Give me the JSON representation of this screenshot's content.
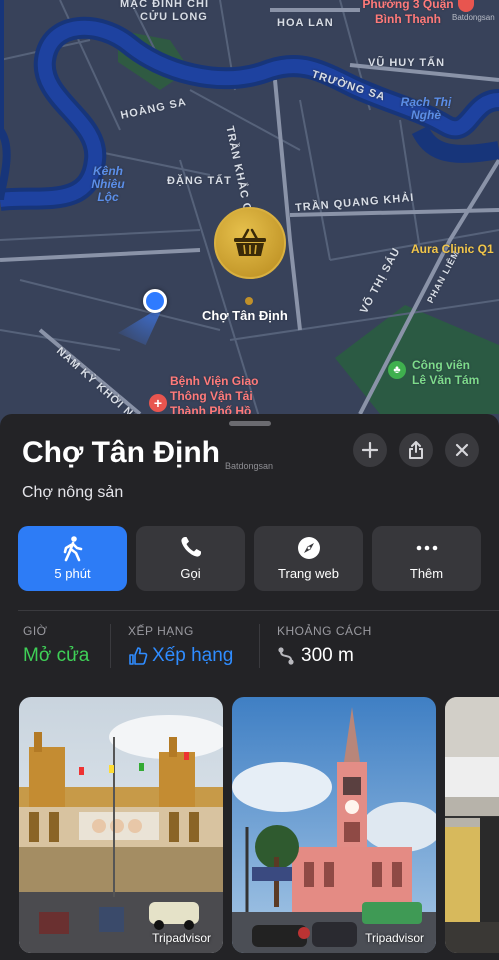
{
  "map": {
    "streets": [
      "MẠC ĐĨNH CHI",
      "CỬU LONG",
      "HOÀNG SA",
      "ĐẶNG TẤT",
      "TRẦN KHẮC CHÂN",
      "TRƯỜNG SA",
      "TRẦN QUANG KHẢI",
      "HOA LAN",
      "VŨ HUY TẤN",
      "VÕ THỊ SÁU",
      "PHAN LIÊM",
      "NAM KỲ KHỞI NG"
    ],
    "water_labels": [
      "Kênh Nhiêu Lộc",
      "Rạch Thị Nghè"
    ],
    "poi_labels": {
      "ward": "Phường 3 Quận Bình Thạnh",
      "clinic": "Aura Clinic Q1",
      "hospital": "Bệnh Viện Giao Thông Vận Tải Thành Phố Hồ",
      "park": "Công viên Lê Văn Tám",
      "market": "Chợ Tân Định"
    },
    "watermark": "Batdongsan"
  },
  "place": {
    "name": "Chợ Tân Định",
    "category": "Chợ nông sản",
    "watermark": "Batdongsan"
  },
  "actions": [
    {
      "label": "5 phút",
      "icon": "walk-icon"
    },
    {
      "label": "Gọi",
      "icon": "phone-icon"
    },
    {
      "label": "Trang web",
      "icon": "compass-icon"
    },
    {
      "label": "Thêm",
      "icon": "more-icon"
    }
  ],
  "info": {
    "hours": {
      "header": "GIỜ",
      "value": "Mở cửa"
    },
    "rating": {
      "header": "XẾP HẠNG",
      "value": "Xếp hạng"
    },
    "distance": {
      "header": "KHOẢNG CÁCH",
      "value": "300 m"
    }
  },
  "photos": [
    {
      "caption": "Tripadvisor"
    },
    {
      "caption": "Tripadvisor"
    }
  ],
  "colors": {
    "primary": "#2d7cf6",
    "open": "#3fd057",
    "rating": "#2f8cff",
    "pin": "#d9b040"
  }
}
